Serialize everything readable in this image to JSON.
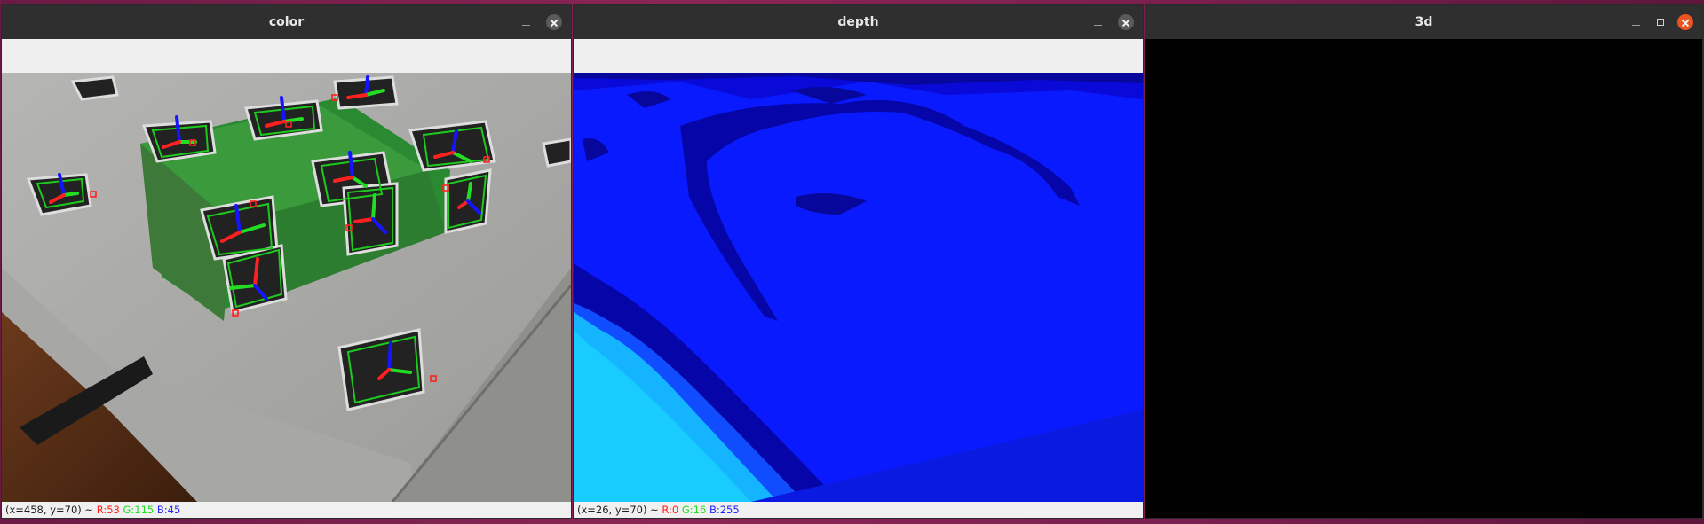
{
  "windows": {
    "color": {
      "title": "color",
      "status": {
        "coords": "(x=458, y=70) ~",
        "r": "R:53",
        "g": "G:115",
        "b": "B:45"
      }
    },
    "depth": {
      "title": "depth",
      "status": {
        "coords": "(x=26, y=70) ~",
        "r": "R:0",
        "g": "G:16",
        "b": "B:255"
      }
    },
    "three_d": {
      "title": "3d"
    }
  },
  "icons": {
    "minimize": "minimize-icon",
    "maximize": "maximize-icon",
    "close": "close-icon"
  },
  "colors": {
    "title_bar": "#2f2f2f",
    "close_active": "#e95420",
    "status_r": "#ff1f1f",
    "status_g": "#22dd22",
    "status_b": "#2222ff",
    "depth_blue": "#0a1aff"
  }
}
